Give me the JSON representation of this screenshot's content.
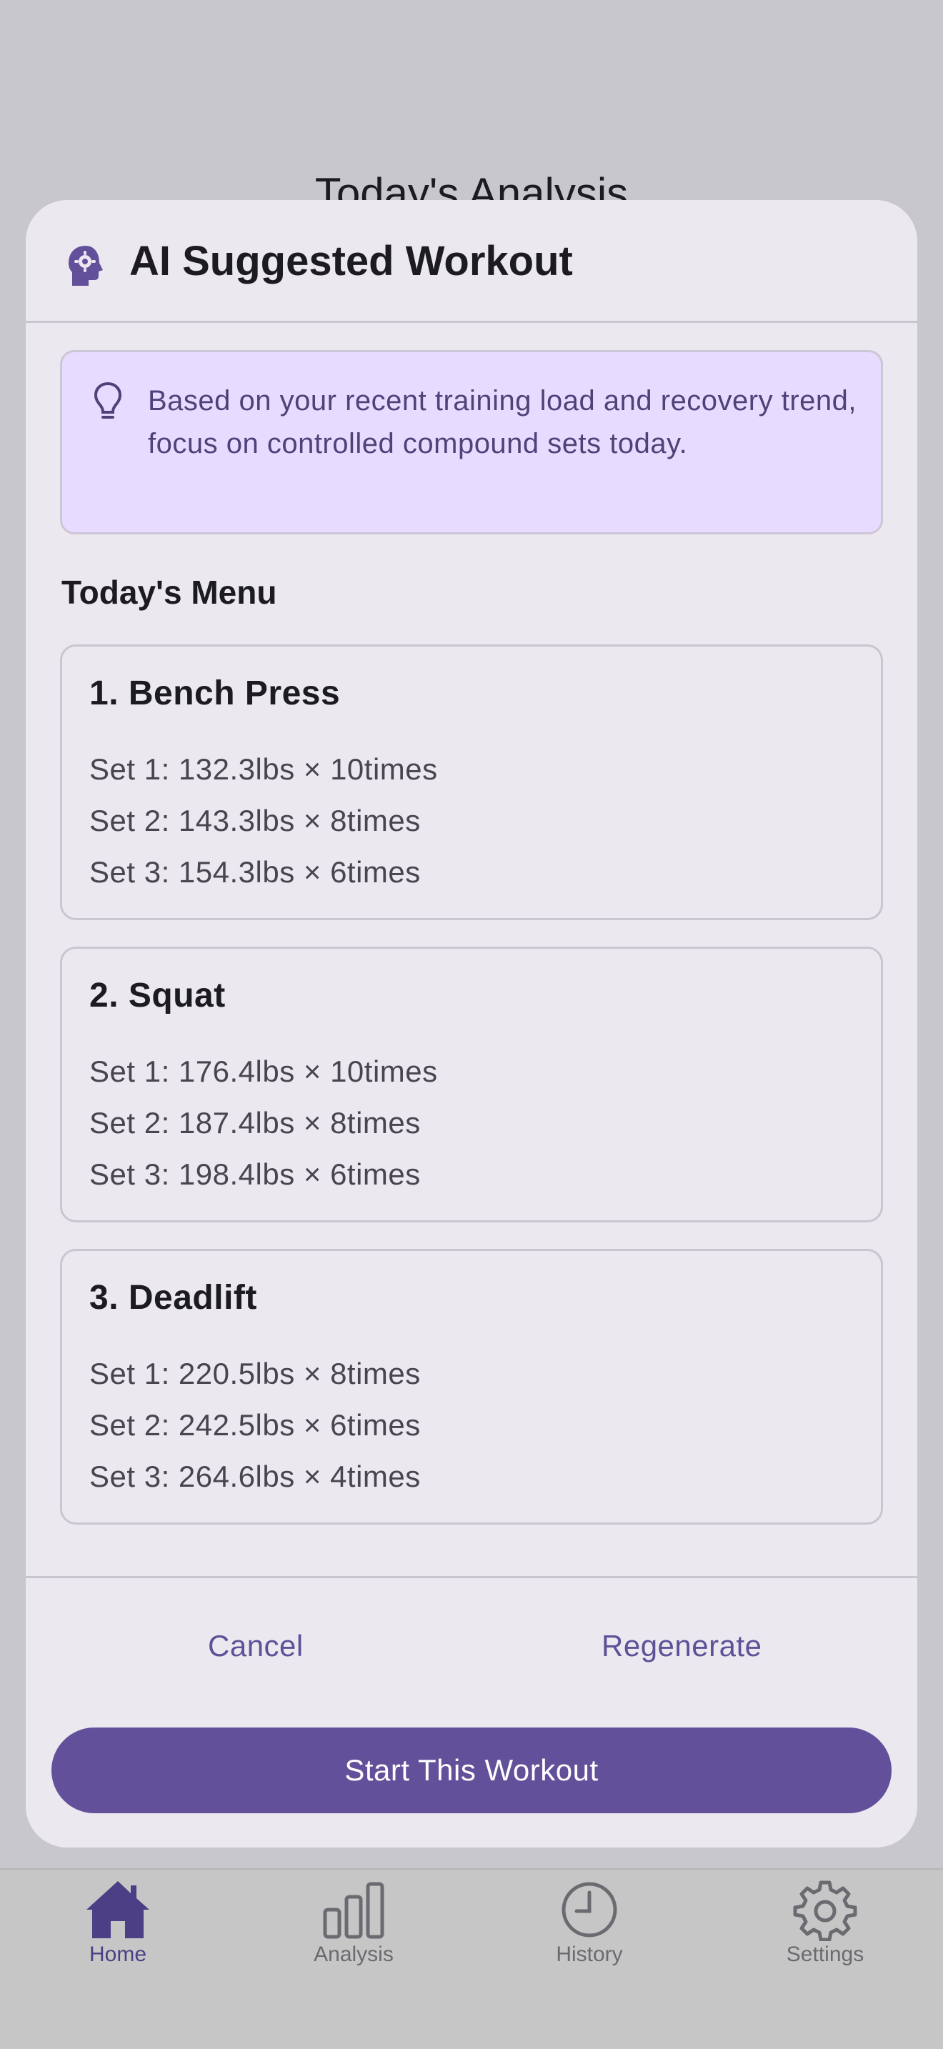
{
  "background": {
    "screen_title": "Today's Analysis"
  },
  "modal": {
    "title": "AI Suggested Workout",
    "tip": "Based on your recent training load and recovery trend, focus on controlled compound sets today.",
    "menu_heading": "Today's Menu",
    "exercises": [
      {
        "name": "1. Bench Press",
        "sets": [
          "Set 1: 132.3lbs × 10times",
          "Set 2: 143.3lbs × 8times",
          "Set 3: 154.3lbs × 6times"
        ]
      },
      {
        "name": "2. Squat",
        "sets": [
          "Set 1: 176.4lbs × 10times",
          "Set 2: 187.4lbs × 8times",
          "Set 3: 198.4lbs × 6times"
        ]
      },
      {
        "name": "3. Deadlift",
        "sets": [
          "Set 1: 220.5lbs × 8times",
          "Set 2: 242.5lbs × 6times",
          "Set 3: 264.6lbs × 4times"
        ]
      }
    ],
    "cancel_label": "Cancel",
    "regenerate_label": "Regenerate",
    "start_label": "Start This Workout"
  },
  "bottom_nav": {
    "items": [
      {
        "label": "Home",
        "icon": "home-icon",
        "active": true
      },
      {
        "label": "Analysis",
        "icon": "bar-chart-icon",
        "active": false
      },
      {
        "label": "History",
        "icon": "clock-icon",
        "active": false
      },
      {
        "label": "Settings",
        "icon": "gear-icon",
        "active": false
      }
    ]
  },
  "colors": {
    "accent": "#62509a",
    "tip_background": "#e7dcff",
    "modal_background": "#ece8ef",
    "scrim": "#c8c7cc"
  }
}
